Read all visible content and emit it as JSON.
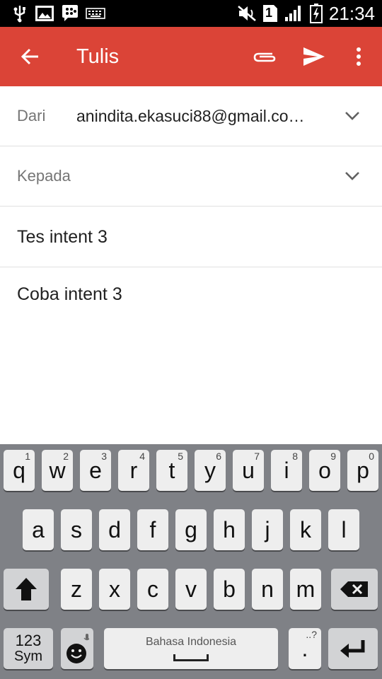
{
  "status_bar": {
    "time": "21:34",
    "sim_slot": "1",
    "left_icons": [
      "usb-icon",
      "image-icon",
      "bbm-icon",
      "keyboard-icon"
    ],
    "right_icons": [
      "mute-icon",
      "sim-icon",
      "signal-icon",
      "battery-charging-icon"
    ]
  },
  "toolbar": {
    "title": "Tulis",
    "color": "#db4437",
    "back_icon": "arrow-left-icon",
    "attach_icon": "paperclip-icon",
    "send_icon": "send-icon",
    "more_icon": "more-vert-icon"
  },
  "compose": {
    "from_label": "Dari",
    "from_value": "anindita.ekasuci88@gmail.co…",
    "to_placeholder": "Kepada",
    "to_value": "",
    "subject": "Tes intent 3",
    "body": "Coba intent 3"
  },
  "keyboard": {
    "row1": [
      {
        "k": "q",
        "h": "1"
      },
      {
        "k": "w",
        "h": "2"
      },
      {
        "k": "e",
        "h": "3"
      },
      {
        "k": "r",
        "h": "4"
      },
      {
        "k": "t",
        "h": "5"
      },
      {
        "k": "y",
        "h": "6"
      },
      {
        "k": "u",
        "h": "7"
      },
      {
        "k": "i",
        "h": "8"
      },
      {
        "k": "o",
        "h": "9"
      },
      {
        "k": "p",
        "h": "0"
      }
    ],
    "row2": [
      "a",
      "s",
      "d",
      "f",
      "g",
      "h",
      "j",
      "k",
      "l"
    ],
    "row3": [
      "z",
      "x",
      "c",
      "v",
      "b",
      "n",
      "m"
    ],
    "sym_label_top": "123",
    "sym_label_bottom": "Sym",
    "space_label": "Bahasa Indonesia",
    "period_label": ".",
    "period_hint": "..?",
    "shift_icon": "shift-icon",
    "backspace_icon": "backspace-icon",
    "emoji_icon": "emoji-mic-icon",
    "enter_icon": "enter-icon"
  }
}
